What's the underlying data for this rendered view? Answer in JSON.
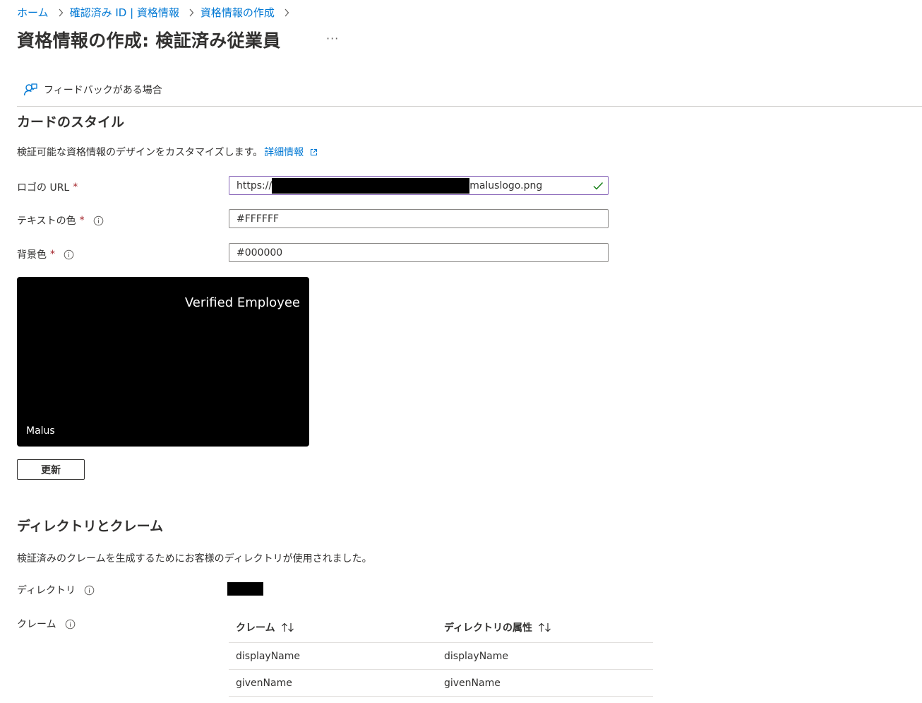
{
  "breadcrumb": {
    "items": [
      "ホーム",
      "確認済み ID | 資格情報",
      "資格情報の作成"
    ]
  },
  "page": {
    "title": "資格情報の作成: 検証済み従業員",
    "more": "···"
  },
  "toolbar": {
    "feedback_label": "フィードバックがある場合"
  },
  "card_style": {
    "heading": "カードのスタイル",
    "description": "検証可能な資格情報のデザインをカスタマイズします。",
    "learn_more": "詳細情報",
    "logo_url": {
      "label": "ロゴの URL",
      "value_prefix": "https://",
      "value_suffix": "maluslogo.png"
    },
    "text_color": {
      "label": "テキストの色",
      "value": "#FFFFFF"
    },
    "background_color": {
      "label": "背景色",
      "value": "#000000"
    },
    "required_marker": "*",
    "preview": {
      "title": "Verified Employee",
      "issuer": "Malus",
      "text_color": "#FFFFFF",
      "background_color": "#000000"
    },
    "update_button": "更新"
  },
  "directory_claims": {
    "heading": "ディレクトリとクレーム",
    "description": "検証済みのクレームを生成するためにお客様のディレクトリが使用されました。",
    "directory_label": "ディレクトリ",
    "claims_label": "クレーム",
    "table": {
      "columns": [
        "クレーム",
        "ディレクトリの属性"
      ],
      "rows": [
        [
          "displayName",
          "displayName"
        ],
        [
          "givenName",
          "givenName"
        ]
      ]
    }
  },
  "colors": {
    "link": "#0078d4",
    "required": "#a4262c",
    "valid_check": "#107c10",
    "focus_border": "#8764b8"
  }
}
